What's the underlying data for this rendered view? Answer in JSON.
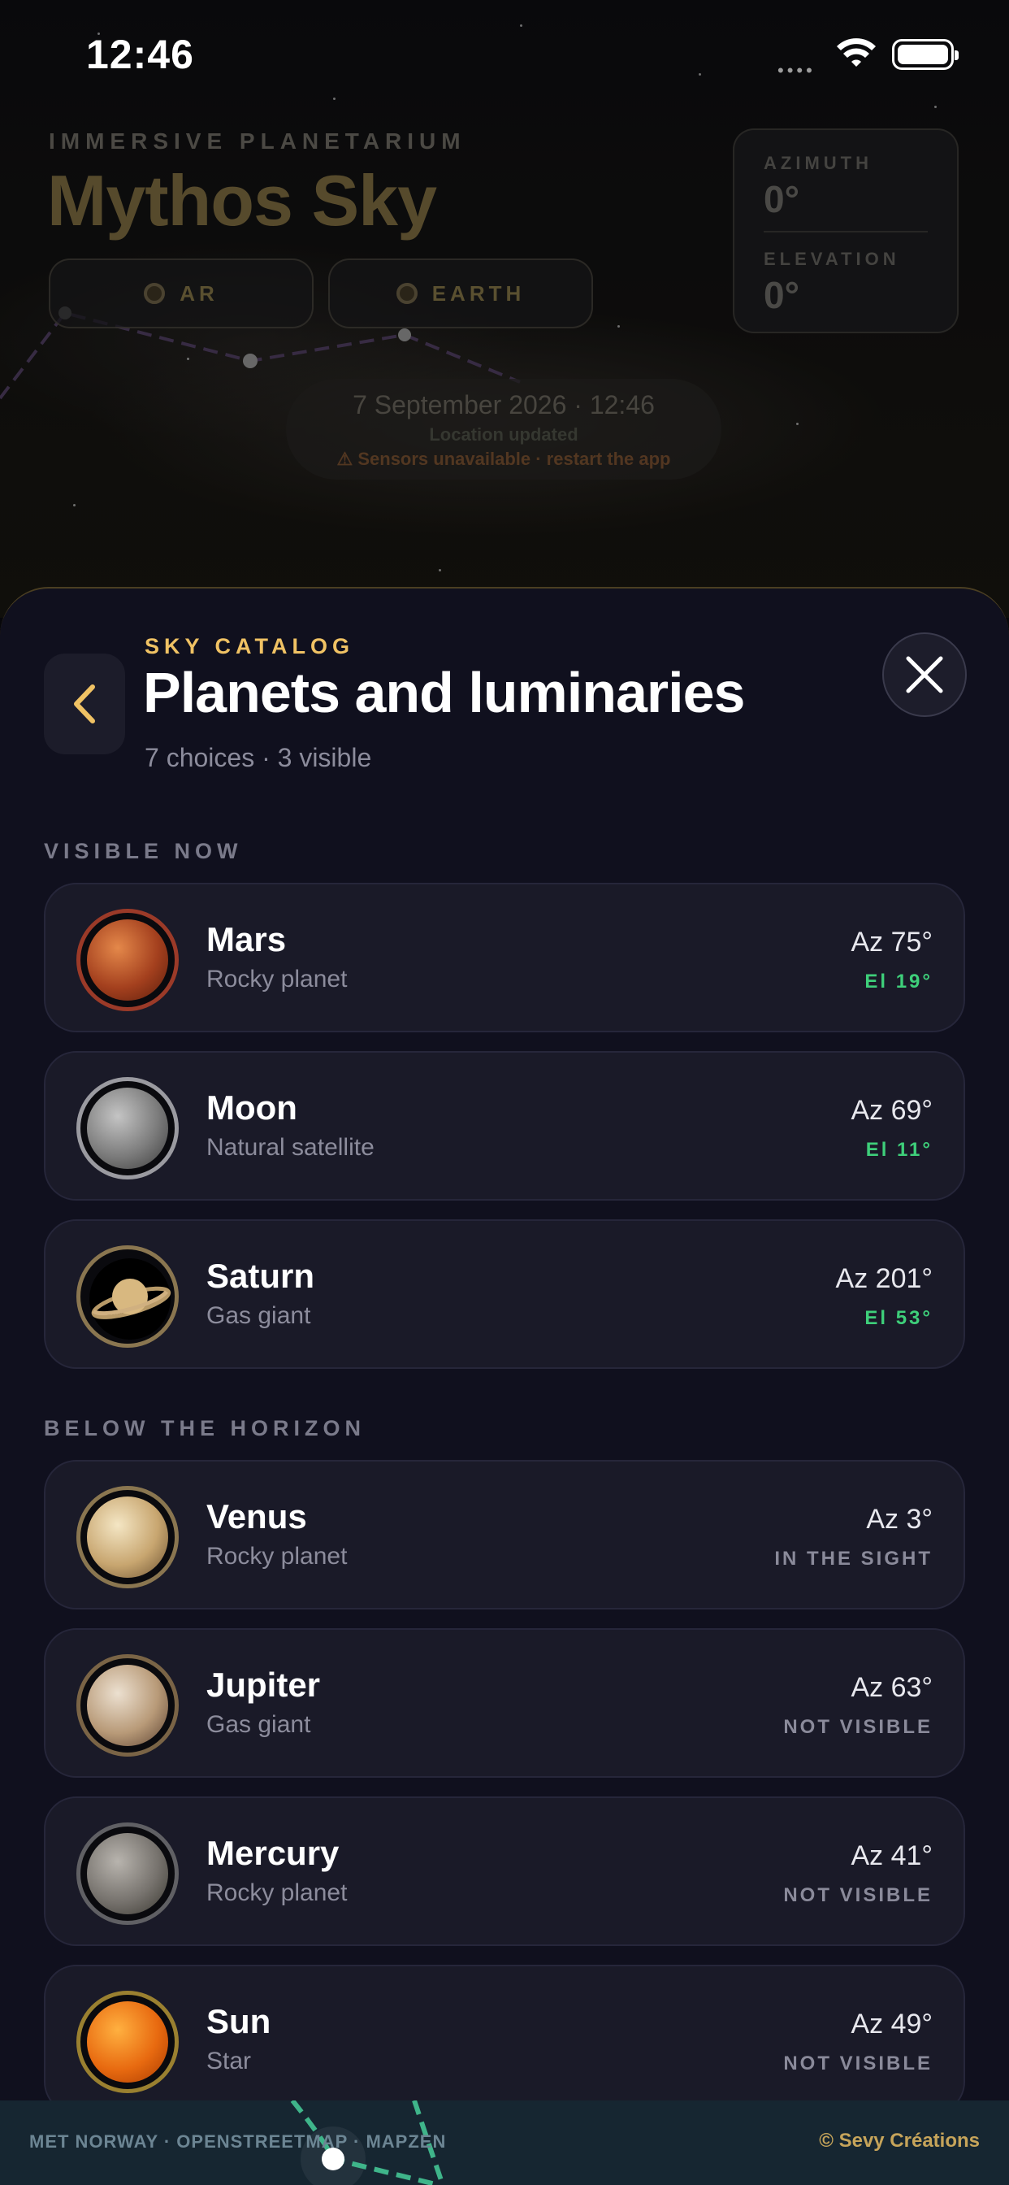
{
  "status_bar": {
    "time": "12:46"
  },
  "header": {
    "subtitle": "IMMERSIVE PLANETARIUM",
    "title": "Mythos Sky",
    "mode_buttons": [
      {
        "label": "AR"
      },
      {
        "label": "EARTH"
      }
    ],
    "azimuth": {
      "label": "AZIMUTH",
      "value": "0°"
    },
    "elevation": {
      "label": "ELEVATION",
      "value": "0°"
    },
    "date_line": "7 September 2026 · 12:46",
    "location_status": "Location updated",
    "sensor_warning": "⚠ Sensors unavailable · restart the app"
  },
  "sheet": {
    "eyebrow": "SKY CATALOG",
    "title": "Planets and luminaries",
    "meta": "7 choices · 3 visible",
    "back_icon": "chevron-left-icon",
    "close_icon": "close-icon",
    "sections": [
      {
        "title": "VISIBLE NOW",
        "items": [
          {
            "name": "Mars",
            "kind": "Rocky planet",
            "azimuth": "Az 75°",
            "state": "El 19°",
            "state_color": "#3ecf7a",
            "ring": "#9b3a28",
            "colors": [
              "#e4884a",
              "#a4401e",
              "#5a1d0c"
            ]
          },
          {
            "name": "Moon",
            "kind": "Natural satellite",
            "azimuth": "Az 69°",
            "state": "El 11°",
            "state_color": "#3ecf7a",
            "ring": "#9a9aa0",
            "colors": [
              "#c4c4c4",
              "#7c7c7c",
              "#3a3a3a"
            ]
          },
          {
            "name": "Saturn",
            "kind": "Gas giant",
            "azimuth": "Az 201°",
            "state": "El 53°",
            "state_color": "#3ecf7a",
            "ring": "#8a7650",
            "colors": [
              "#e8d0a0",
              "#b08a50",
              "#000000"
            ]
          }
        ]
      },
      {
        "title": "BELOW THE HORIZON",
        "items": [
          {
            "name": "Venus",
            "kind": "Rocky planet",
            "azimuth": "Az 3°",
            "state": "IN THE SIGHT",
            "state_color": "#8a8a9a",
            "ring": "#8a7650",
            "colors": [
              "#f4e6c4",
              "#c8a670",
              "#6a5030"
            ]
          },
          {
            "name": "Jupiter",
            "kind": "Gas giant",
            "azimuth": "Az 63°",
            "state": "NOT VISIBLE",
            "state_color": "#8a8a9a",
            "ring": "#7a6446",
            "colors": [
              "#ece0d0",
              "#b89a78",
              "#5a4030"
            ]
          },
          {
            "name": "Mercury",
            "kind": "Rocky planet",
            "azimuth": "Az 41°",
            "state": "NOT VISIBLE",
            "state_color": "#8a8a9a",
            "ring": "#606064",
            "colors": [
              "#b8b4ae",
              "#77736e",
              "#38362f"
            ]
          },
          {
            "name": "Sun",
            "kind": "Star",
            "azimuth": "Az 49°",
            "state": "NOT VISIBLE",
            "state_color": "#8a8a9a",
            "ring": "#9a8030",
            "colors": [
              "#ffb040",
              "#e86a10",
              "#a83a00"
            ]
          }
        ]
      }
    ]
  },
  "footer": {
    "credits": "MET NORWAY · OPENSTREETMAP · MAPZEN",
    "brand": "© Sevy Créations"
  },
  "colors": {
    "accent": "#f0c264",
    "visible": "#3ecf7a",
    "sheet_bg": "#10101e",
    "row_bg": "#1a1a28"
  }
}
